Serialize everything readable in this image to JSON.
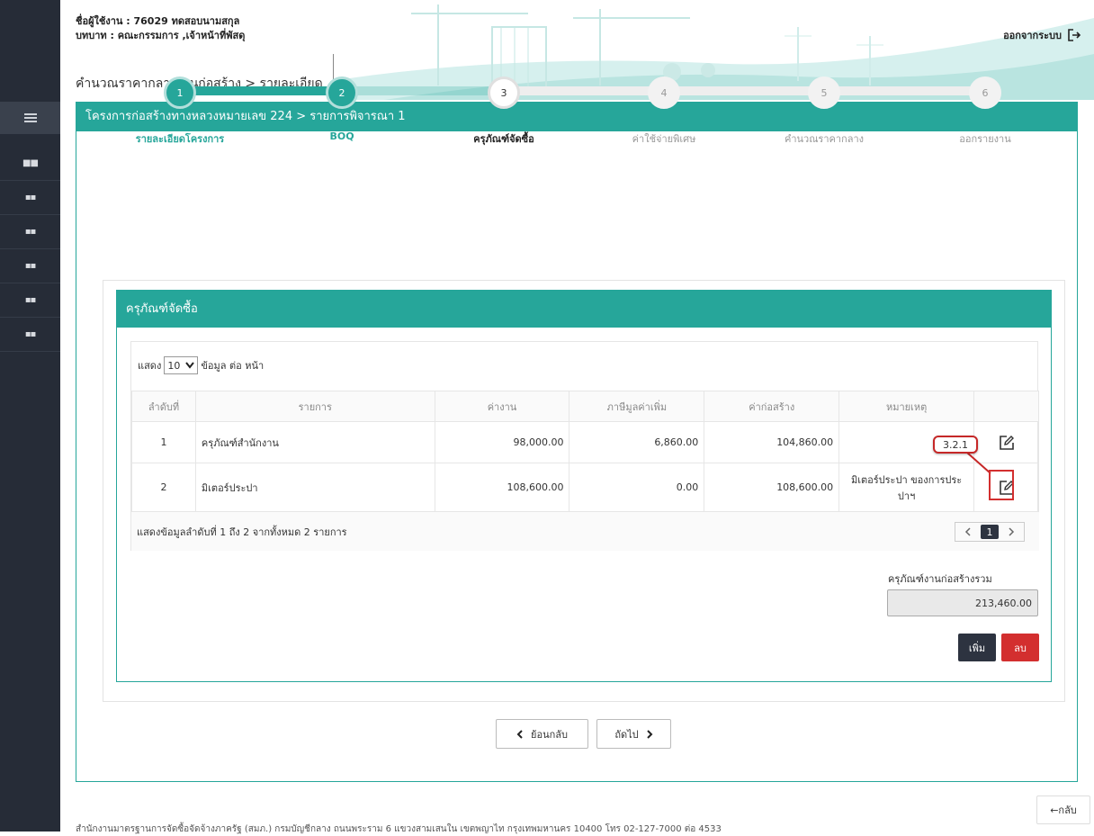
{
  "header": {
    "user_line": "ชื่อผู้ใช้งาน : 76029 ทดสอบนามสกุล",
    "role_line": "บทบาท : คณะกรรมการ ,เจ้าหน้าที่พัสดุ",
    "breadcrumb": "คำนวณราคากลางงานก่อสร้าง > รายละเอียด",
    "logout_label": "ออกจากระบบ"
  },
  "panel": {
    "title": "โครงการก่อสร้างทางหลวงหมายเลข 224 > รายการพิจารณา 1"
  },
  "steps": [
    {
      "number": "1",
      "label": "รายละเอียดโครงการ",
      "state": "done"
    },
    {
      "number": "2",
      "label": "BOQ",
      "state": "done"
    },
    {
      "number": "3",
      "label": "ครุภัณฑ์จัดซื้อ",
      "state": "current"
    },
    {
      "number": "4",
      "label": "ค่าใช้จ่ายพิเศษ",
      "state": "todo"
    },
    {
      "number": "5",
      "label": "คำนวณราคากลาง",
      "state": "todo"
    },
    {
      "number": "6",
      "label": "ออกรายงาน",
      "state": "todo"
    }
  ],
  "card": {
    "title": "ครุภัณฑ์จัดซื้อ",
    "length_prefix": "แสดง",
    "length_value": "10",
    "length_suffix": "ข้อมูล ต่อ หน้า",
    "columns": [
      "ลำดับที่",
      "รายการ",
      "ค่างาน",
      "ภาษีมูลค่าเพิ่ม",
      "ค่าก่อสร้าง",
      "หมายเหตุ",
      ""
    ],
    "rows": [
      {
        "no": "1",
        "item": "ครุภัณฑ์สำนักงาน",
        "cost": "98,000.00",
        "vat": "6,860.00",
        "total": "104,860.00",
        "note": ""
      },
      {
        "no": "2",
        "item": "มิเตอร์ประปา",
        "cost": "108,600.00",
        "vat": "0.00",
        "total": "108,600.00",
        "note": "มิเตอร์ประปา ของการประปาฯ"
      }
    ],
    "info": "แสดงข้อมูลลำดับที่ 1 ถึง 2 จากทั้งหมด 2 รายการ",
    "page_current": "1",
    "total_label": "ครุภัณฑ์งานก่อสร้างรวม",
    "total_value": "213,460.00",
    "add_label": "เพิ่ม",
    "delete_label": "ลบ"
  },
  "annotation": {
    "label": "3.2.1"
  },
  "nav": {
    "back_label": "ย้อนกลับ",
    "next_label": "ถัดไป"
  },
  "float_back": "←กลับ",
  "footer_text": "สำนักงานมาตรฐานการจัดซื้อจัดจ้างภาครัฐ (สมภ.) กรมบัญชีกลาง ถนนพระราม 6 แขวงสามเสนใน เขตพญาไท กรุงเทพมหานคร 10400 โทร 02-127-7000 ต่อ 4533",
  "colors": {
    "teal": "#26a69a",
    "sidebar": "#262c37",
    "dark_button": "#2d3340",
    "danger": "#d32f2f"
  }
}
